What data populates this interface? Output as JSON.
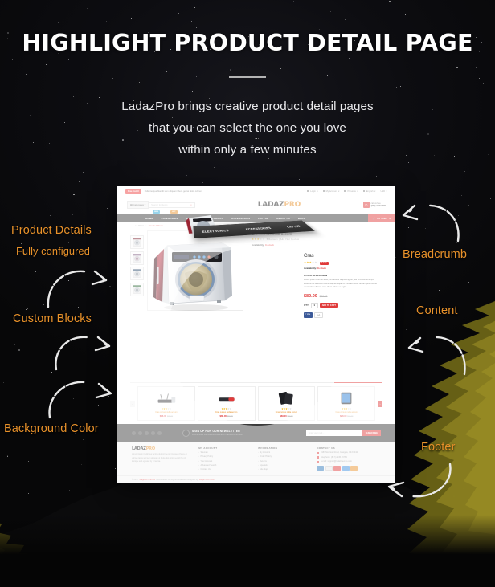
{
  "colors": {
    "accent_orange": "#e8912a",
    "accent_red": "#e03b3b",
    "heading_white": "#ffffff",
    "dark_nav": "#3a3a3a"
  },
  "header": {
    "title": "HIGHLIGHT PRODUCT DETAIL PAGE",
    "subtitle_line1": "LadazPro brings creative product detail pages",
    "subtitle_line2": "that you can select the one you love",
    "subtitle_line3": "within only a few minutes"
  },
  "annotations": {
    "left": [
      {
        "id": "product-details",
        "label": "Product Details"
      },
      {
        "id": "fully-configured",
        "label": "Fully configured"
      },
      {
        "id": "custom-blocks",
        "label": "Custom Blocks"
      },
      {
        "id": "background-color",
        "label": "Background Color"
      }
    ],
    "right": [
      {
        "id": "breadcrumb",
        "label": "Breadcrumb"
      },
      {
        "id": "content",
        "label": "Content"
      },
      {
        "id": "footer",
        "label": "Footer"
      }
    ]
  },
  "mockup": {
    "topbar": {
      "promo_badge": "Free Install",
      "promo_text": "Pellentesque blandit sem aliquam libero gernsi dolor ochrem",
      "links": [
        "Login",
        "My Account",
        "Previous",
        "English",
        "USD"
      ]
    },
    "headerbar": {
      "categories_label": "Categories",
      "search_placeholder": "Search for items",
      "search_icon": "search-icon",
      "logo_main": "LADAZ",
      "logo_accent": "PRO",
      "phone_icon": "phone-icon",
      "phone_label": "call us free",
      "phone_number": "(800) 2345 6789"
    },
    "nav": {
      "items": [
        "HOME",
        "CATEGORIES",
        "MODULE",
        "ELECTRONICS",
        "ACCESSORIES",
        "LAPTOP",
        "ABOUT US",
        "BLOG"
      ],
      "badge_new": "NEW",
      "badge_hot": "HOT",
      "cart_icon": "cart-icon",
      "cart_label": "MY CART",
      "cart_count": "0"
    },
    "breadcrumb": {
      "home": "Home",
      "sep": "»",
      "current": "Double Effects"
    },
    "perspective_menu": [
      "ELECTRONICS",
      "ACCESSORIES",
      "LAPTOP"
    ],
    "product": {
      "title": "Cras cursus nulla accum",
      "stars_filled": 3,
      "stars_total": 5,
      "review_text": "5 Reviews  |  Add Your Review",
      "availability_label": "Availability:",
      "availability_value": "In stock",
      "sale_badge": "SALE",
      "short_title": "Cras",
      "quick_overview_label": "QUICK OVERVIEW",
      "description": "Lorem ipsum dolor sit amet, consectetur adipisicing elit, sed do eiusmod tempor incididunt ut labore et dolore magna aliqua. Ut enim ad minim veniam quis nostrud exercitation ullamco esse cillum dolore eu fugiat.",
      "price_now": "$80.00",
      "price_was": "$90.00",
      "qty_label": "QTY:",
      "qty_value": "1",
      "add_to_cart": "ADD TO CART",
      "facebook_label": "Like",
      "google_label": "g+1"
    },
    "related": {
      "items": [
        {
          "name": "Cras cursus nulla accum",
          "price": "$86.00",
          "old": "$95.00",
          "stars": 3
        },
        {
          "name": "Cras cursus nulla accum",
          "price": "$80.00",
          "old": "$90.00",
          "stars": 3
        },
        {
          "name": "Cras cursus nulla accum",
          "price": "$69.00",
          "old": "$79.00",
          "stars": 3
        },
        {
          "name": "Cras cursus nulla accum",
          "price": "$88.00",
          "old": "$99.00",
          "stars": 3
        }
      ],
      "prev_icon": "chevron-left-icon",
      "next_icon": "chevron-right-icon"
    },
    "newsletter": {
      "title": "SIGN UP FOR OUR NEWSLETTER",
      "subtitle": "Duis at mollis nisl rhoncus consectetur mauris sit amet nibh",
      "placeholder": "Enter your mail...",
      "button": "SUBSCRIBE",
      "social_icons": [
        "facebook-icon",
        "twitter-icon",
        "rss-icon",
        "pinterest-icon",
        "google-plus-icon"
      ]
    },
    "footer": {
      "logo_main": "LADAZ",
      "logo_accent": "PRO",
      "about": "Lorem ipsum in ultricies lacinia duis sit the pri tristique id fusce et ultrices lacus sed sem aliquam ut ligula duis tortor sed id the pri tristique and egestas by in lacinia.",
      "columns": [
        {
          "heading": "MY ACCOUNT",
          "links": [
            "Sitemap",
            "Privacy Policy",
            "Your Account",
            "Advanced Search",
            "Contact Us"
          ]
        },
        {
          "heading": "INFORMATION",
          "links": [
            "My Account",
            "Order History",
            "Returns",
            "Specials",
            "Site Map"
          ]
        }
      ],
      "contact_heading": "CONTACT US",
      "contact_items": [
        "1987 Morrison Road, Glasgow, G43 0042",
        "Telephone: (817) 2245 - 6789",
        "E-mail: support@ladazthemes.com"
      ],
      "payment_cards": [
        "amex-card",
        "paypal-card",
        "mastercard-card",
        "visa-card",
        "discover-card"
      ],
      "copyright_pre": "© 2017 ",
      "copyright_brand": "Magento Themes",
      "copyright_mid": " Demo Store. All Rights Reserved. Designed by ",
      "copyright_link": "MagenTech.Com"
    }
  }
}
